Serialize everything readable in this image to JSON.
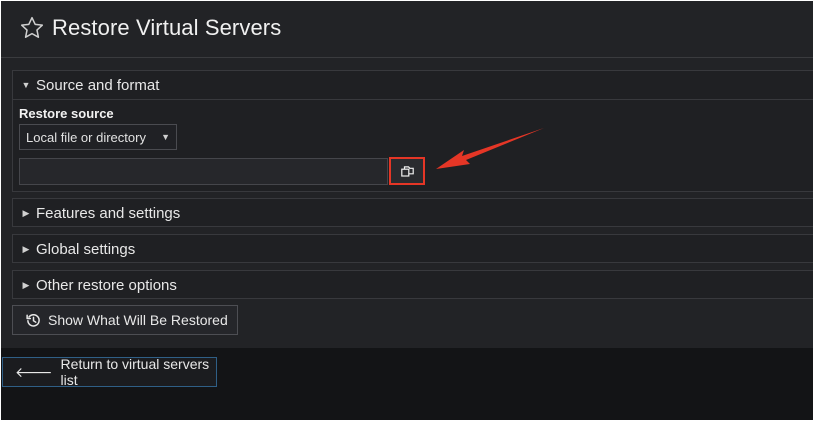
{
  "page": {
    "title": "Restore Virtual Servers"
  },
  "sections": {
    "source": {
      "label": "Source and format",
      "restore_source_label": "Restore source",
      "select_value": "Local file or directory",
      "path_value": "",
      "path_placeholder": ""
    },
    "features": {
      "label": "Features and settings"
    },
    "global": {
      "label": "Global settings"
    },
    "other": {
      "label": "Other restore options"
    }
  },
  "buttons": {
    "show_restored": "Show What Will Be Restored",
    "return": "Return to virtual servers list"
  },
  "colors": {
    "background": "#222326",
    "highlight_red": "#e53626",
    "return_border": "#2f5f86"
  },
  "icons": {
    "favorite": "star-icon",
    "collapse": "triangle-icon",
    "browse": "file-chooser-icon",
    "history": "history-icon",
    "back": "left-arrow-icon"
  }
}
